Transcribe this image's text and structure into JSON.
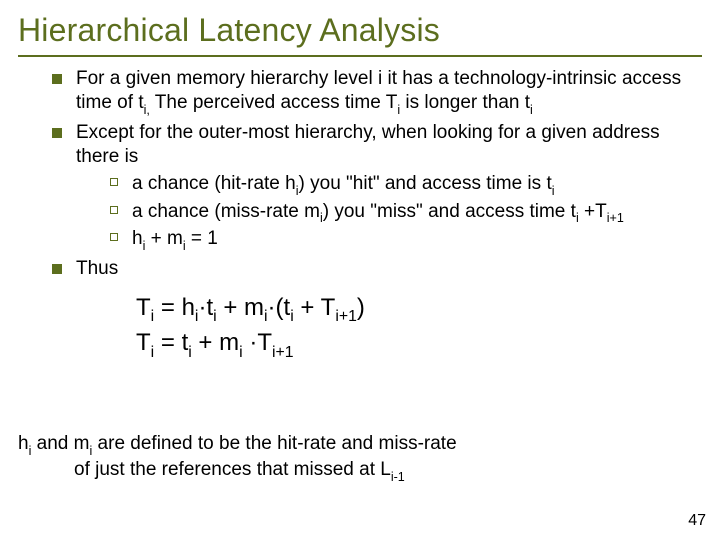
{
  "title": "Hierarchical Latency Analysis",
  "bullets": {
    "item1_pre": "For a given memory hierarchy level ",
    "item1_i": "i",
    "item1_mid1": " it has a technology-intrinsic access time of ",
    "item1_t": "t",
    "item1_sub_i1": "i,",
    "item1_mid2": " The perceived access time ",
    "item1_T": "T",
    "item1_sub_i2": "i",
    "item1_mid3": " is longer than ",
    "item1_t2": "t",
    "item1_sub_i3": "i",
    "item2": "Except for the outer-most hierarchy, when looking for a given address there is",
    "sub1_pre": "a chance (hit-rate ",
    "sub1_h": "h",
    "sub1_sub_i": "i",
    "sub1_mid": ") you \"hit\" and access time is ",
    "sub1_t": "t",
    "sub1_sub_i2": "i",
    "sub2_pre": "a chance (miss-rate ",
    "sub2_m": "m",
    "sub2_sub_i": "i",
    "sub2_mid": ") you \"miss\" and access time ",
    "sub2_t": "t",
    "sub2_sub_i2": "i",
    "sub2_plus": " +",
    "sub2_T": "T",
    "sub2_sub_ip1": "i+1",
    "sub3_h": "h",
    "sub3_sub_i1": "i",
    "sub3_plus": " + ",
    "sub3_m": "m",
    "sub3_sub_i2": "i",
    "sub3_eq": " = 1",
    "item3": "Thus"
  },
  "formula": {
    "line1_T": "T",
    "line1_sub_i": "i",
    "line1_eq": " = ",
    "line1_h": "h",
    "line1_sub_i2": "i",
    "line1_dot_t": "·t",
    "line1_sub_i3": "i",
    "line1_plus": "  + ",
    "line1_m": "m",
    "line1_sub_i4": "i",
    "line1_dot_p": "·(",
    "line1_t": "t",
    "line1_sub_i5": "i",
    "line1_plus2": " + ",
    "line1_T2": "T",
    "line1_sub_ip1": "i+1",
    "line1_close": ")",
    "line2_T": "T",
    "line2_sub_i": "i",
    "line2_eq": " = ",
    "line2_t": "t",
    "line2_sub_i2": "i",
    "line2_plus": "  + ",
    "line2_m": "m",
    "line2_sub_i3": "i",
    "line2_dot": " ·",
    "line2_T2": "T",
    "line2_sub_ip1": "i+1"
  },
  "footer": {
    "h": "h",
    "sub_i1": "i",
    "and": " and ",
    "m": "m",
    "sub_i2": "i",
    "text1": " are defined to be the hit-rate and miss-rate",
    "text2": "of just the references that missed at ",
    "L": "L",
    "sub_im1": "i-1"
  },
  "pagenum": "47"
}
